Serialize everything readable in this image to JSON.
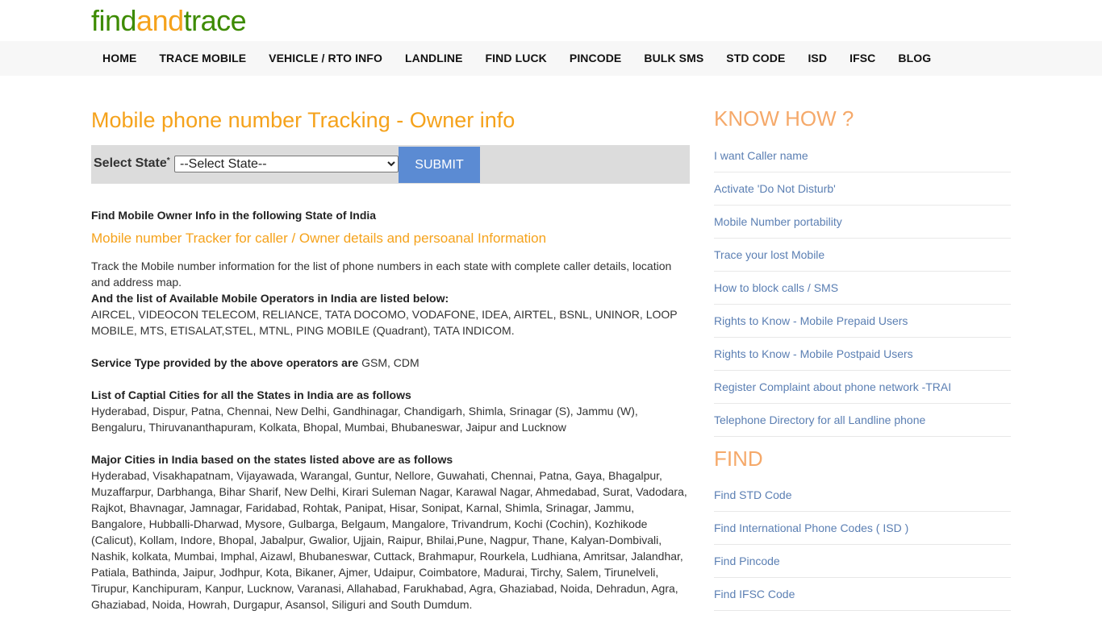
{
  "brand": {
    "part1": "find",
    "part2": "and",
    "part3": "trace"
  },
  "nav": [
    "HOME",
    "TRACE MOBILE",
    "VEHICLE / RTO INFO",
    "LANDLINE",
    "FIND LUCK",
    "PINCODE",
    "BULK SMS",
    "STD CODE",
    "ISD",
    "IFSC",
    "BLOG"
  ],
  "main": {
    "title": "Mobile phone number Tracking - Owner info",
    "form": {
      "label": "Select State",
      "required_mark": "*",
      "select_value": "--Select State--",
      "submit_label": "SUBMIT"
    },
    "section_heading": "Find Mobile Owner Info in the following State of India",
    "sub_heading": "Mobile number Tracker for caller / Owner details and persoanal Information",
    "intro": "Track the Mobile number information for the list of phone numbers in each state with complete caller details, location and address map.",
    "operators_heading": "And the list of Available Mobile Operators in India are listed below:",
    "operators_list": "AIRCEL, VIDEOCON TELECOM, RELIANCE, TATA DOCOMO, VODAFONE, IDEA, AIRTEL, BSNL, UNINOR, LOOP MOBILE, MTS, ETISALAT,STEL, MTNL, PING MOBILE (Quadrant), TATA INDICOM.",
    "service_label": "Service Type provided by the above operators are",
    "service_value": "GSM, CDM",
    "capitals_heading": "List of Captial Cities for all the States in India are as follows",
    "capitals_list": "Hyderabad, Dispur, Patna, Chennai, New Delhi, Gandhinagar, Chandigarh, Shimla, Srinagar (S), Jammu (W), Bengaluru, Thiruvananthapuram, Kolkata, Bhopal, Mumbai, Bhubaneswar, Jaipur and Lucknow",
    "major_heading": "Major Cities in India based on the states listed above are as follows",
    "major_list": "Hyderabad, Visakhapatnam, Vijayawada, Warangal, Guntur, Nellore, Guwahati, Chennai, Patna, Gaya, Bhagalpur, Muzaffarpur, Darbhanga, Bihar Sharif, New Delhi, Kirari Suleman Nagar, Karawal Nagar, Ahmedabad, Surat, Vadodara, Rajkot, Bhavnagar, Jamnagar, Faridabad, Rohtak, Panipat, Hisar, Sonipat, Karnal, Shimla, Srinagar, Jammu, Bangalore, Hubballi-Dharwad, Mysore, Gulbarga, Belgaum, Mangalore, Trivandrum, Kochi (Cochin), Kozhikode (Calicut), Kollam, Indore, Bhopal, Jabalpur, Gwalior, Ujjain, Raipur, Bhilai,Pune, Nagpur, Thane, Kalyan-Dombivali, Nashik, kolkata, Mumbai, Imphal, Aizawl, Bhubaneswar, Cuttack, Brahmapur, Rourkela, Ludhiana, Amritsar, Jalandhar, Patiala, Bathinda, Jaipur, Jodhpur, Kota, Bikaner, Ajmer, Udaipur, Coimbatore, Madurai, Tirchy, Salem, Tirunelveli, Tirupur, Kanchipuram, Kanpur, Lucknow, Varanasi, Allahabad, Farukhabad, Agra, Ghaziabad, Noida, Dehradun, Agra, Ghaziabad, Noida, Howrah, Durgapur, Asansol, Siliguri and South Dumdum."
  },
  "sidebar": {
    "know_how_heading": "KNOW HOW ?",
    "know_how_links": [
      "I want Caller name",
      "Activate 'Do Not Disturb'",
      "Mobile Number portability",
      "Trace your lost Mobile",
      "How to block calls / SMS",
      "Rights to Know - Mobile Prepaid Users",
      "Rights to Know - Mobile Postpaid Users",
      "Register Complaint about phone network -TRAI",
      "Telephone Directory for all Landline phone"
    ],
    "find_heading": "FIND",
    "find_links": [
      "Find STD Code",
      "Find International Phone Codes ( ISD )",
      "Find Pincode",
      "Find IFSC Code"
    ]
  }
}
